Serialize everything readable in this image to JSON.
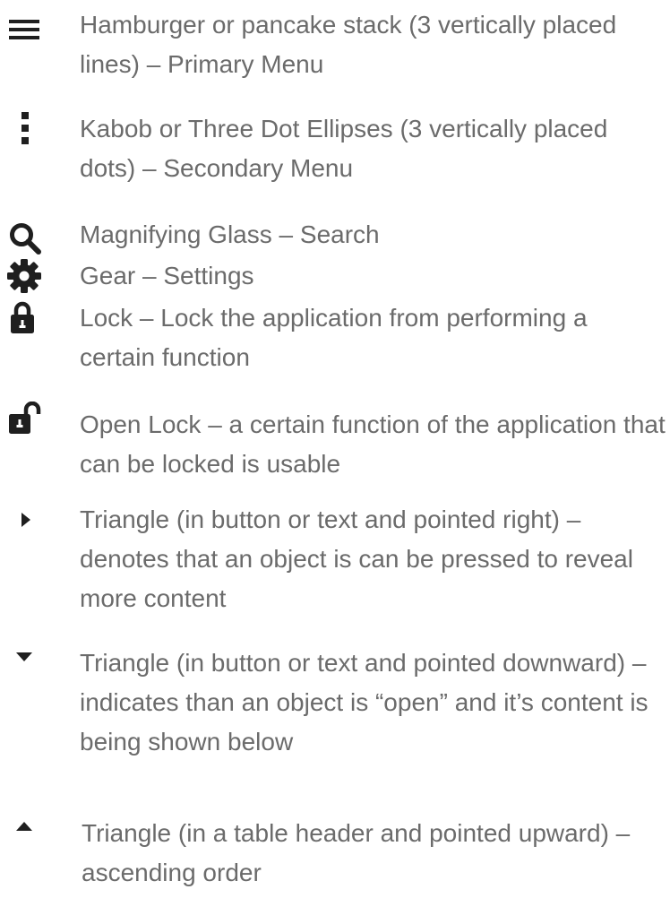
{
  "items": [
    {
      "icon": "hamburger-icon",
      "text": "Hamburger or pancake stack (3 vertically placed lines) – Primary Menu"
    },
    {
      "icon": "kebab-icon",
      "text": "Kabob or Three Dot Ellipses (3 vertically placed dots) – Secondary Menu"
    },
    {
      "icon": "search-icon",
      "text": "Magnifying Glass – Search"
    },
    {
      "icon": "gear-icon",
      "text": "Gear – Settings"
    },
    {
      "icon": "lock-icon",
      "text": "Lock – Lock the application from performing a certain function"
    },
    {
      "icon": "open-lock-icon",
      "text": "Open Lock – a certain function of the application that can be locked is usable"
    },
    {
      "icon": "triangle-right-icon",
      "text": "Triangle (in button or text and pointed right) – denotes that an object is can be pressed to reveal more content"
    },
    {
      "icon": "triangle-down-icon",
      "text": "Triangle (in button or text and pointed downward) – indicates than an object is “open” and it’s content is being shown below"
    },
    {
      "icon": "triangle-up-icon",
      "text": "Triangle (in a table header and pointed upward) – ascending order"
    }
  ],
  "colors": {
    "text": "#6b6b6b",
    "icon": "#1f1f1f"
  }
}
